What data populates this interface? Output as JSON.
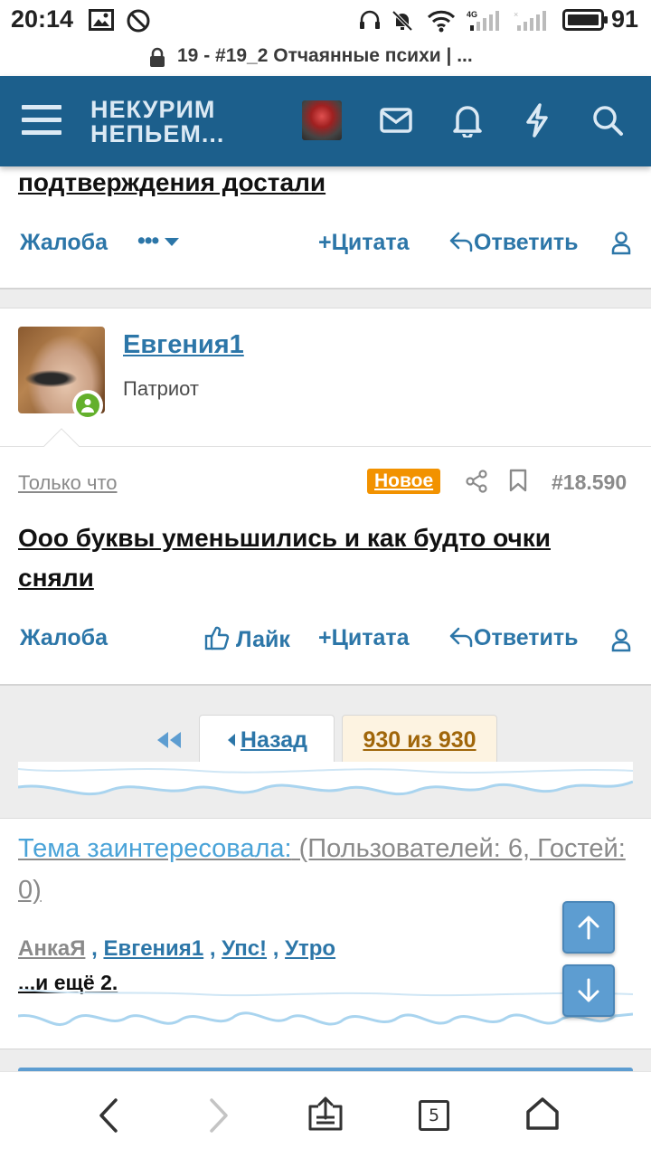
{
  "status_bar": {
    "time": "20:14",
    "battery": "91"
  },
  "url_bar": {
    "title": "19 - #19_2 Отчаянные психи | ..."
  },
  "header": {
    "logo_line1": "НЕКУРИМ",
    "logo_line2": "НЕПЬЕМ..."
  },
  "post_prev": {
    "text_tail": "подтверждения достали",
    "report": "Жалоба",
    "more": "•••",
    "quote": "Цитата",
    "reply": "Ответить"
  },
  "post": {
    "author": "Евгения1",
    "user_title": "Патриот",
    "date": "Только что",
    "badge": "Новое",
    "number": "#18.590",
    "text": "Ооо буквы уменьшились и как будто очки сняли",
    "report": "Жалоба",
    "like": "Лайк",
    "quote": "Цитата",
    "reply": "Ответить"
  },
  "pagination": {
    "back": "Назад",
    "count": "930 из 930"
  },
  "viewers": {
    "heading_link": "Тема заинтересовала:",
    "heading_rest": " (Пользователей: 6, Гостей: 0)",
    "names": [
      "АнкаЯ",
      "Евгения1",
      "Упс!",
      "Утро"
    ],
    "separator": " , ",
    "more": "...и ещё 2."
  },
  "browser": {
    "tabs_count": "5"
  },
  "colors": {
    "header_bg": "#1c5f8c",
    "link": "#2c76a8",
    "badge": "#f29200",
    "online": "#63b02c"
  }
}
